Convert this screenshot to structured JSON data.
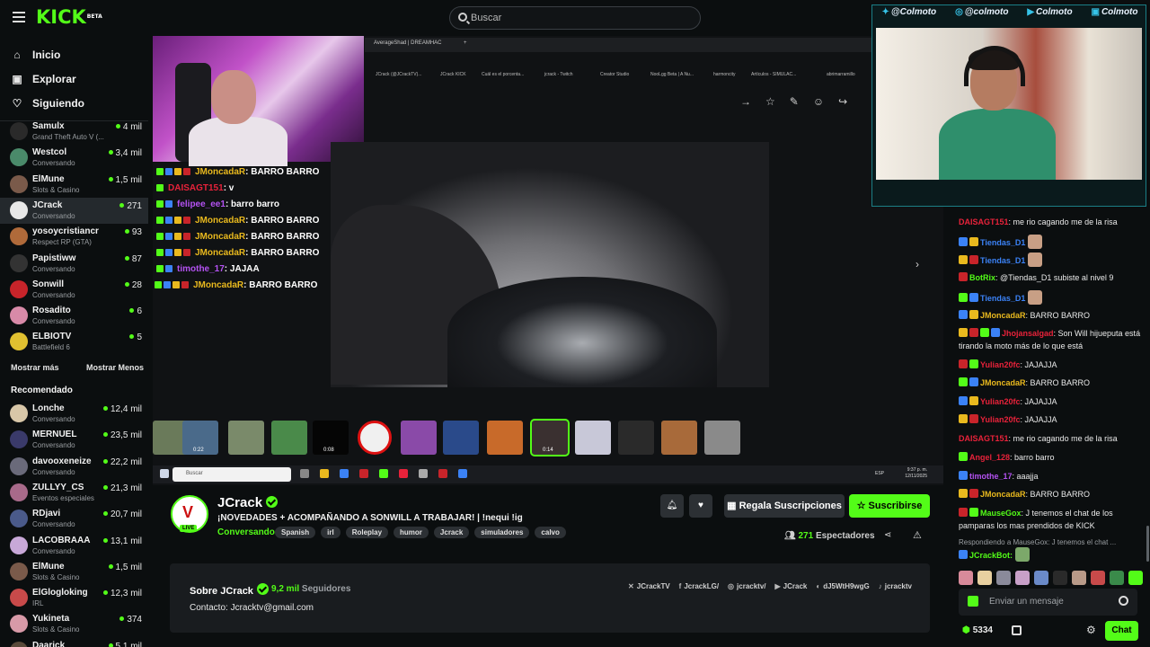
{
  "header": {
    "logo": "KICK",
    "logo_beta": "BETA",
    "search_placeholder": "Buscar"
  },
  "sidebar": {
    "nav": [
      {
        "label": "Inicio",
        "icon": "home-icon"
      },
      {
        "label": "Explorar",
        "icon": "compass-icon"
      },
      {
        "label": "Siguiendo",
        "icon": "heart-icon"
      }
    ],
    "following": [
      {
        "name": "Samulx",
        "sub": "Grand Theft Auto V (...",
        "viewers": "4 mil",
        "color": "#2a2a2a"
      },
      {
        "name": "Westcol",
        "sub": "Conversando",
        "viewers": "3,4 mil",
        "color": "#4a8a6a"
      },
      {
        "name": "ElMune",
        "sub": "Slots & Casino",
        "viewers": "1,5 mil",
        "color": "#7a5a4a"
      },
      {
        "name": "JCrack",
        "sub": "Conversando",
        "viewers": "271",
        "color": "#e8e8e8"
      },
      {
        "name": "yosoycristiancr",
        "sub": "Respect RP (GTA)",
        "viewers": "93",
        "color": "#b06a3a"
      },
      {
        "name": "Papistiww",
        "sub": "Conversando",
        "viewers": "87",
        "color": "#333333"
      },
      {
        "name": "Sonwill",
        "sub": "Conversando",
        "viewers": "28",
        "color": "#c8242a"
      },
      {
        "name": "Rosadito",
        "sub": "Conversando",
        "viewers": "6",
        "color": "#d88aa8"
      },
      {
        "name": "ELBIOTV",
        "sub": "Battlefield 6",
        "viewers": "5",
        "color": "#e0c030"
      }
    ],
    "show_more": "Mostrar más",
    "show_less": "Mostrar Menos",
    "recommended_heading": "Recomendado",
    "recommended": [
      {
        "name": "Lonche",
        "sub": "Conversando",
        "viewers": "12,4 mil",
        "color": "#d8c7a8"
      },
      {
        "name": "MERNUEL",
        "sub": "Conversando",
        "viewers": "23,5 mil",
        "color": "#3a3a6a"
      },
      {
        "name": "davooxeneize",
        "sub": "Conversando",
        "viewers": "22,2 mil",
        "color": "#6a6a7a"
      },
      {
        "name": "ZULLYY_CS",
        "sub": "Eventos especiales",
        "viewers": "21,3 mil",
        "color": "#a86a8a"
      },
      {
        "name": "RDjavi",
        "sub": "Conversando",
        "viewers": "20,7 mil",
        "color": "#4a5a8a"
      },
      {
        "name": "LACOBRAAA",
        "sub": "Conversando",
        "viewers": "13,1 mil",
        "color": "#c8a8d8"
      },
      {
        "name": "ElMune",
        "sub": "Slots & Casino",
        "viewers": "1,5 mil",
        "color": "#7a5a4a"
      },
      {
        "name": "ElGlogloking",
        "sub": "IRL",
        "viewers": "12,3 mil",
        "color": "#c84a4a"
      },
      {
        "name": "Yukineta",
        "sub": "Slots & Casino",
        "viewers": "374",
        "color": "#d89aa8"
      },
      {
        "name": "Daarick",
        "sub": "",
        "viewers": "5,1 mil",
        "color": "#5a4a3a"
      }
    ]
  },
  "player": {
    "browser_tabs": [
      "AverageShad | DREAMHAC",
      "+"
    ],
    "bookmarks": [
      "JCrack (@JCrackTV)...",
      "JCrack KICK",
      "Cuál es el porcenta...",
      "jcrack - Twitch",
      "Creator Studio",
      "NooLgg Beta | A Nu...",
      "harmoncity",
      "Artículos - SIMULAC...",
      "abrimarramillo"
    ],
    "overlay_chat": [
      {
        "user": "JMoncadaR",
        "text": ": BARRO BARRO",
        "color": "#e9b91e"
      },
      {
        "user": "DAISAGT151",
        "text": ": v",
        "color": "#e8223a"
      },
      {
        "user": "felipee_ee1",
        "text": ": barro barro",
        "color": "#b452f2"
      },
      {
        "user": "JMoncadaR",
        "text": ": BARRO BARRO",
        "color": "#e9b91e"
      },
      {
        "user": "JMoncadaR",
        "text": ": BARRO BARRO",
        "color": "#e9b91e"
      },
      {
        "user": "JMoncadaR",
        "text": ": BARRO BARRO",
        "color": "#e9b91e"
      },
      {
        "user": "timothe_17",
        "text": ": JAJAA",
        "color": "#b452f2"
      },
      {
        "user": "JMoncadaR",
        "text": ": BARRO BARRO",
        "color": "#e9b91e"
      }
    ],
    "thumb_labels": [
      "0:22",
      "0:08",
      "0:14"
    ],
    "taskbar_search": "Buscar",
    "taskbar_lang": "ESP",
    "taskbar_time": "9:37 p. m.",
    "taskbar_date": "12/11/2025"
  },
  "stream": {
    "channel": "JCrack",
    "live_label": "LIVE",
    "title": "¡NOVEDADES + ACOMPAÑANDO A SONWILL A TRABAJAR! | !nequi !ig",
    "category": "Conversando",
    "tags": [
      "Spanish",
      "irl",
      "Roleplay",
      "humor",
      "Jcrack",
      "simuladores",
      "calvo"
    ],
    "gift_label": "Regala Suscripciones",
    "subscribe_label": "Suscribirse",
    "viewers_count": "271",
    "viewers_label": "Espectadores",
    "about_title": "Sobre JCrack",
    "followers_count": "9,2 mil",
    "followers_label": "Seguidores",
    "contact": "Contacto: Jcracktv@gmail.com",
    "socials": [
      {
        "icon": "x-icon",
        "glyph": "✕",
        "label": "JCrackTV"
      },
      {
        "icon": "facebook-icon",
        "glyph": "f",
        "label": "JcrackLG/"
      },
      {
        "icon": "instagram-icon",
        "glyph": "◎",
        "label": "jcracktv/"
      },
      {
        "icon": "youtube-icon",
        "glyph": "▶",
        "label": "JCrack"
      },
      {
        "icon": "discord-icon",
        "glyph": "◐",
        "label": "dJ5WtH9wgG"
      },
      {
        "icon": "tiktok-icon",
        "glyph": "♪",
        "label": "jcracktv"
      }
    ]
  },
  "cam2": {
    "handles": [
      {
        "icon": "twitter-icon",
        "glyph": "✦",
        "label": "@Colmoto"
      },
      {
        "icon": "instagram-icon",
        "glyph": "◎",
        "label": "@colmoto"
      },
      {
        "icon": "youtube-icon",
        "glyph": "▶",
        "label": "Colmoto"
      },
      {
        "icon": "twitch-icon",
        "glyph": "▣",
        "label": "Colmoto"
      }
    ]
  },
  "chat": {
    "messages": [
      {
        "user": "DAISAGT151",
        "text": ": me rio cagando me de la risa",
        "color": "#e8223a",
        "emote": false
      },
      {
        "user": "Tiendas_D1",
        "text": "",
        "color": "#3b82f6",
        "emote": true
      },
      {
        "user": "Tiendas_D1",
        "text": "",
        "color": "#3b82f6",
        "emote": true
      },
      {
        "user": "BotRix",
        "text": ": @Tiendas_D1 subiste al nivel 9",
        "color": "#53fc18",
        "emote": false
      },
      {
        "user": "Tiendas_D1",
        "text": "",
        "color": "#3b82f6",
        "emote": true
      },
      {
        "user": "JMoncadaR",
        "text": ": BARRO BARRO",
        "color": "#e9b91e",
        "emote": false
      },
      {
        "user": "Jhojansalgad",
        "text": ": Son Will hijueputa está tirando la moto más de lo que está",
        "color": "#e8223a",
        "emote": false
      },
      {
        "user": "Yulian20fc",
        "text": ": JAJAJJA",
        "color": "#e8223a",
        "emote": false
      },
      {
        "user": "JMoncadaR",
        "text": ": BARRO BARRO",
        "color": "#e9b91e",
        "emote": false
      },
      {
        "user": "Yulian20fc",
        "text": ": JAJAJJA",
        "color": "#e8223a",
        "emote": false
      },
      {
        "user": "Yulian20fc",
        "text": ": JAJAJJA",
        "color": "#e8223a",
        "emote": false
      },
      {
        "user": "DAISAGT151",
        "text": ": me rio cagando me de la risa",
        "color": "#e8223a",
        "emote": false
      },
      {
        "user": "Angel_128",
        "text": ": barro barro",
        "color": "#e8223a",
        "emote": false
      },
      {
        "user": "timothe_17",
        "text": ": aaajja",
        "color": "#b452f2",
        "emote": false
      },
      {
        "user": "JMoncadaR",
        "text": ": BARRO BARRO",
        "color": "#e9b91e",
        "emote": false
      },
      {
        "user": "MauseGox",
        "text": ": J tenemos el chat de los pamparas los mas prendidos de KICK",
        "color": "#53fc18",
        "emote": false
      }
    ],
    "reply_hint": "Respondiendo a MauseGox: J tenemos el chat ...",
    "bot_reply_user": "JCrackBot:",
    "input_placeholder": "Enviar un mensaje",
    "points": "5334",
    "chat_button": "Chat"
  }
}
